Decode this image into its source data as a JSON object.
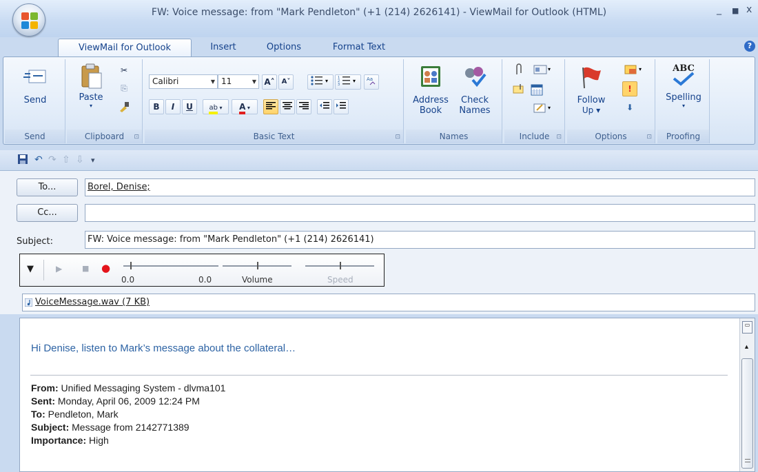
{
  "window": {
    "title": "FW: Voice message: from \"Mark Pendleton\" (+1 (214) 2626141) - ViewMail for Outlook (HTML)",
    "minimize": "_",
    "maximize": "■",
    "close": "x"
  },
  "tabs": [
    {
      "label": "ViewMail for Outlook",
      "active": true
    },
    {
      "label": "Insert"
    },
    {
      "label": "Options"
    },
    {
      "label": "Format Text"
    }
  ],
  "help_glyph": "?",
  "ribbon": {
    "send": {
      "button": "Send",
      "group": "Send"
    },
    "clipboard": {
      "paste": "Paste",
      "group": "Clipboard",
      "cut_glyph": "✂",
      "copy_glyph": "⎘"
    },
    "basic_text": {
      "font": "Calibri",
      "size": "11",
      "group": "Basic Text",
      "bold": "B",
      "italic": "I",
      "underline": "U",
      "grow_font": "A˄",
      "shrink_font": "A˅",
      "font_color": "A",
      "highlight": "ab"
    },
    "names": {
      "address_book_1": "Address",
      "address_book_2": "Book",
      "check_names_1": "Check",
      "check_names_2": "Names",
      "group": "Names"
    },
    "include": {
      "group": "Include"
    },
    "options": {
      "follow_up_1": "Follow",
      "follow_up_2": "Up ▾",
      "importance_high": "!",
      "importance_low": "⬇",
      "group": "Options"
    },
    "proofing": {
      "abc": "ABC",
      "spelling": "Spelling",
      "group": "Proofing"
    }
  },
  "qat": {
    "more": "▾"
  },
  "form": {
    "to_button": "To...",
    "to_value": "Borel, Denise;",
    "cc_button": "Cc...",
    "cc_value": "",
    "subject_label": "Subject:",
    "subject_value": "FW: Voice message: from \"Mark Pendleton\" (+1 (214) 2626141)"
  },
  "player": {
    "menu": "▼",
    "play": "▶",
    "stop": "■",
    "record": "●",
    "position": "0.0",
    "duration": "0.0",
    "position_level": 0.07,
    "volume_label": "Volume",
    "volume_level": 0.5,
    "speed_label": "Speed",
    "speed_level": 0.5
  },
  "attachment": {
    "name": "VoiceMessage.wav (7 KB)"
  },
  "body": {
    "greeting": "Hi Denise,  listen to Mark’s message about the collateral…",
    "from_label": "From:",
    "from": " Unified Messaging System - dlvma101",
    "sent_label": "Sent:",
    "sent": " Monday, April 06, 2009 12:24 PM",
    "to_label": "To:",
    "to": " Pendleton, Mark",
    "subject_label": "Subject:",
    "subject": " Message from 2142771389",
    "importance_label": "Importance:",
    "importance": " High"
  }
}
